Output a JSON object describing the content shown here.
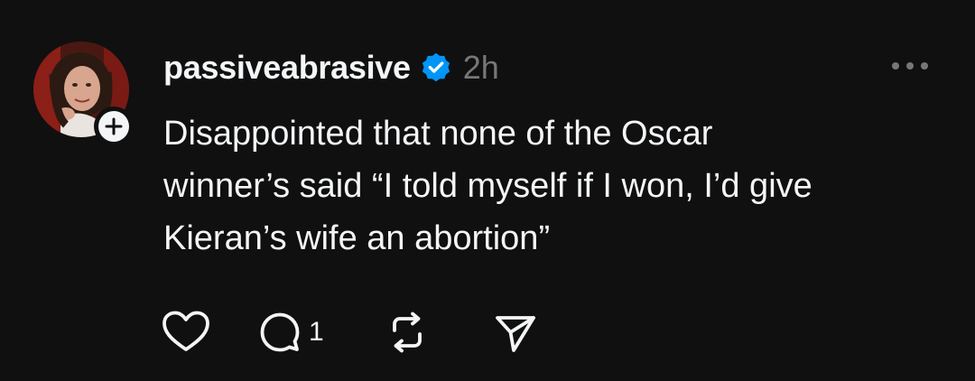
{
  "post": {
    "username": "passiveabrasive",
    "timestamp": "2h",
    "text": "Disappointed that none of the Oscar\nwinner’s said “I told myself if I won, I’d give\nKieran’s wife an abortion”",
    "verified": true,
    "reply_count": "1"
  },
  "icons": {
    "verified": "verified-badge-icon",
    "follow": "plus-icon",
    "more": "more-options-icon",
    "like": "heart-icon",
    "reply": "comment-icon",
    "repost": "repost-icon",
    "share": "send-icon"
  },
  "colors": {
    "background": "#101010",
    "text": "#f3f5f7",
    "muted": "#777777",
    "verified": "#0095f6"
  }
}
